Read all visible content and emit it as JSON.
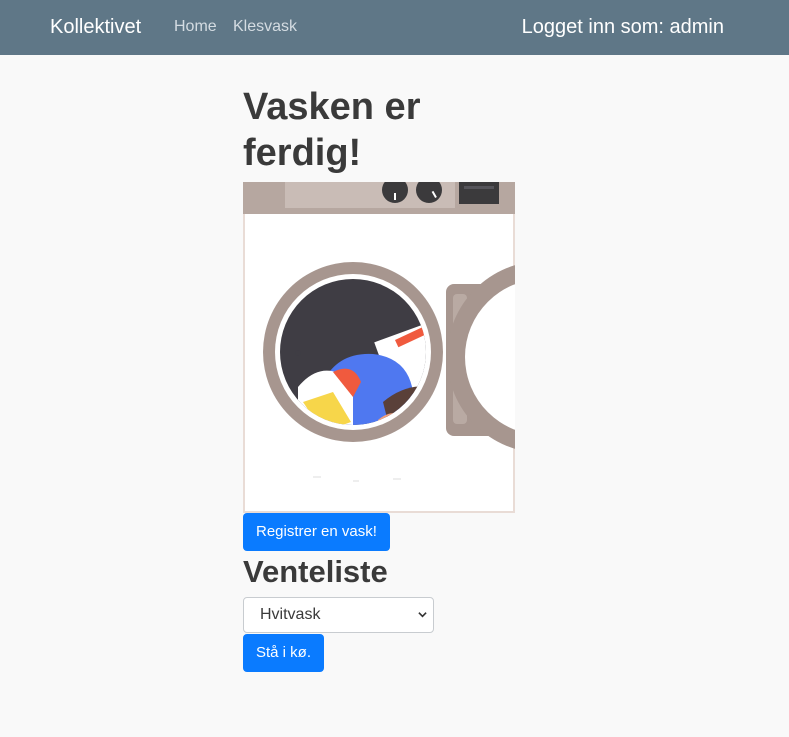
{
  "navbar": {
    "brand": "Kollektivet",
    "links": [
      "Home",
      "Klesvask"
    ],
    "user_status": "Logget inn som: admin"
  },
  "main": {
    "title": "Vasken er ferdig!",
    "illustration_icon": "washing-machine-illustration",
    "register_button": "Registrer en vask!",
    "queue_heading": "Venteliste",
    "wash_type_selected": "Hvitvask",
    "queue_button": "Stå i kø."
  },
  "colors": {
    "navbar": "#5f7787",
    "primary_button": "#0a7bff",
    "background": "#f9f9f9"
  }
}
